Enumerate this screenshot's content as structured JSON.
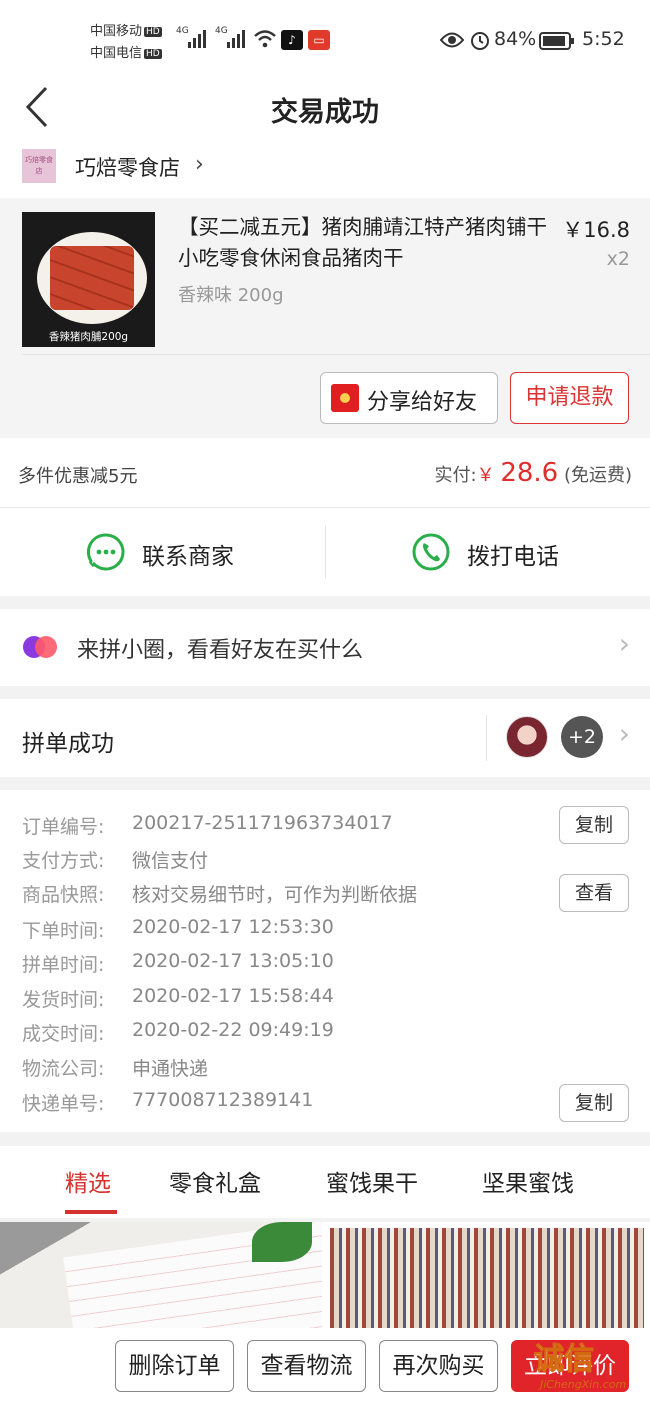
{
  "status_bar": {
    "carrier1": "中国移动",
    "carrier2": "中国电信",
    "hd": "HD",
    "net1": "4G",
    "net2": "4G",
    "battery": "84%",
    "time": "5:52"
  },
  "header": {
    "title": "交易成功"
  },
  "shop": {
    "logo_text": "巧焙零食店",
    "name": "巧焙零食店"
  },
  "product": {
    "title": "【买二减五元】猪肉脯靖江特产猪肉铺干小吃零食休闲食品猪肉干",
    "spec": "香辣味 200g",
    "price": "￥16.8",
    "qty": "x2",
    "image_caption": "香辣猪肉脯200g",
    "share_label": "分享给好友",
    "refund_label": "申请退款"
  },
  "summary": {
    "discount": "多件优惠减5元",
    "paid_label": "实付:",
    "currency": "￥",
    "paid_amount": "28.6",
    "shipping": "(免运费)"
  },
  "contact": {
    "merchant": "联系商家",
    "call": "拨打电话"
  },
  "circle": {
    "label": "来拼小圈，看看好友在买什么"
  },
  "group": {
    "label": "拼单成功",
    "more": "+2"
  },
  "order_info": {
    "rows": [
      {
        "key": "订单编号:",
        "value": "200217-251171963734017"
      },
      {
        "key": "支付方式:",
        "value": "微信支付"
      },
      {
        "key": "商品快照:",
        "value": "核对交易细节时，可作为判断依据"
      },
      {
        "key": "下单时间:",
        "value": "2020-02-17 12:53:30"
      },
      {
        "key": "拼单时间:",
        "value": "2020-02-17 13:05:10"
      },
      {
        "key": "发货时间:",
        "value": "2020-02-17 15:58:44"
      },
      {
        "key": "成交时间:",
        "value": "2020-02-22 09:49:19"
      },
      {
        "key": "物流公司:",
        "value": "申通快递"
      },
      {
        "key": "快递单号:",
        "value": "777008712389141"
      }
    ],
    "copy_label": "复制",
    "view_label": "查看"
  },
  "tabs": [
    "精选",
    "零食礼盒",
    "蜜饯果干",
    "坚果蜜饯"
  ],
  "actions": {
    "delete": "删除订单",
    "logistics": "查看物流",
    "rebuy": "再次购买",
    "review": "立即评价"
  },
  "watermark": {
    "brand": "诚信",
    "site": "JiChengXin.com"
  },
  "colors": {
    "accent": "#e0242a",
    "green": "#2aae4a"
  }
}
